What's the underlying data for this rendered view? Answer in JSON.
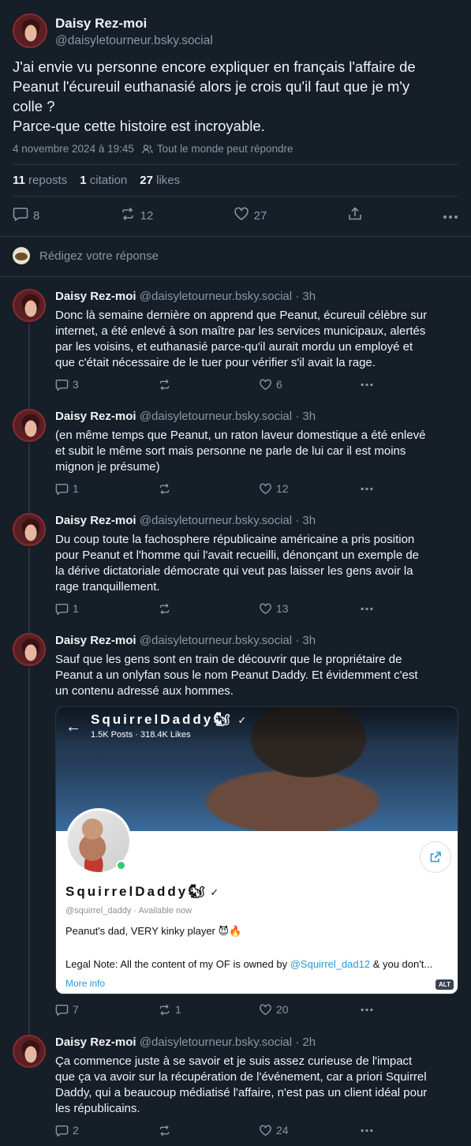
{
  "main_post": {
    "author_name": "Daisy Rez-moi",
    "author_handle": "@daisyletourneur.bsky.social",
    "text_lines": [
      "J'ai envie vu personne encore expliquer en français l'affaire de",
      "Peanut l'écureuil euthanasié alors je crois qu'il faut que je m'y",
      "colle ?",
      "Parce-que cette histoire est incroyable."
    ],
    "date": "4 novembre 2024 à 19:45",
    "reply_setting": "Tout le monde peut répondre",
    "reposts_count": "11",
    "reposts_label": "reposts",
    "quotes_count": "1",
    "quotes_label": "citation",
    "likes_count": "27",
    "likes_label": "likes",
    "actions": {
      "replies": "8",
      "reposts": "12",
      "likes": "27"
    }
  },
  "reply_box": {
    "placeholder": "Rédigez votre réponse"
  },
  "thread": [
    {
      "author_name": "Daisy Rez-moi",
      "author_handle": "@daisyletourneur.bsky.social",
      "time": "· 3h",
      "lines": [
        "Donc là semaine dernière on apprend que Peanut, écureuil célèbre sur",
        "internet, a été enlevé à son maître par les services municipaux, alertés",
        "par les voisins, et euthanasié parce-qu'il aurait mordu un employé et",
        "que c'était nécessaire de le tuer pour vérifier s'il avait la rage."
      ],
      "replies": "3",
      "reposts": "",
      "likes": "6"
    },
    {
      "author_name": "Daisy Rez-moi",
      "author_handle": "@daisyletourneur.bsky.social",
      "time": "· 3h",
      "lines": [
        "(en même temps que Peanut, un raton laveur domestique a été enlevé",
        "et subit le même sort mais personne ne parle de lui car il est moins",
        "mignon je présume)"
      ],
      "replies": "1",
      "reposts": "",
      "likes": "12"
    },
    {
      "author_name": "Daisy Rez-moi",
      "author_handle": "@daisyletourneur.bsky.social",
      "time": "· 3h",
      "lines": [
        "Du coup toute la fachosphere républicaine américaine a pris position",
        "pour Peanut et l'homme qui l'avait recueilli, dénonçant un exemple de",
        "la dérive dictatoriale démocrate qui veut pas laisser les gens avoir la",
        "rage tranquillement."
      ],
      "replies": "1",
      "reposts": "",
      "likes": "13"
    },
    {
      "author_name": "Daisy Rez-moi",
      "author_handle": "@daisyletourneur.bsky.social",
      "time": "· 3h",
      "lines": [
        "Sauf que les gens sont en train de découvrir que le propriétaire de",
        "Peanut a un onlyfan sous le nom Peanut Daddy. Et évidemment c'est",
        "un contenu adressé aux hommes."
      ],
      "replies": "7",
      "reposts": "1",
      "likes": "20"
    },
    {
      "author_name": "Daisy Rez-moi",
      "author_handle": "@daisyletourneur.bsky.social",
      "time": "· 2h",
      "lines": [
        "Ça commence juste à se savoir et je suis assez curieuse de l'impact",
        "que ça va avoir sur la récupération de l'événement, car a priori Squirrel",
        "Daddy, qui a beaucoup médiatisé l'affaire, n'est pas un client idéal pour",
        "les républicains."
      ],
      "replies": "2",
      "reposts": "",
      "likes": "24"
    }
  ],
  "embed": {
    "title": "SquirrelDaddy",
    "title_emoji": "🐿",
    "stats": "1.5K Posts  ·  318.4K Likes",
    "name": "SquirrelDaddy",
    "handle": "@squirrel_daddy  ·  Available now",
    "bio": "Peanut's dad, VERY kinky player",
    "bio_emoji": "😈🔥",
    "legal_prefix": "Legal Note: All the content of my OF is owned by ",
    "legal_link": "@Squirrel_dad12",
    "legal_suffix": " & you don't...",
    "more": "More info",
    "alt": "ALT"
  },
  "colors": {
    "background": "#161e27",
    "text": "#f1f3f5",
    "muted": "#8a96a5",
    "divider": "#2a3542",
    "link": "#2a9bd8"
  }
}
